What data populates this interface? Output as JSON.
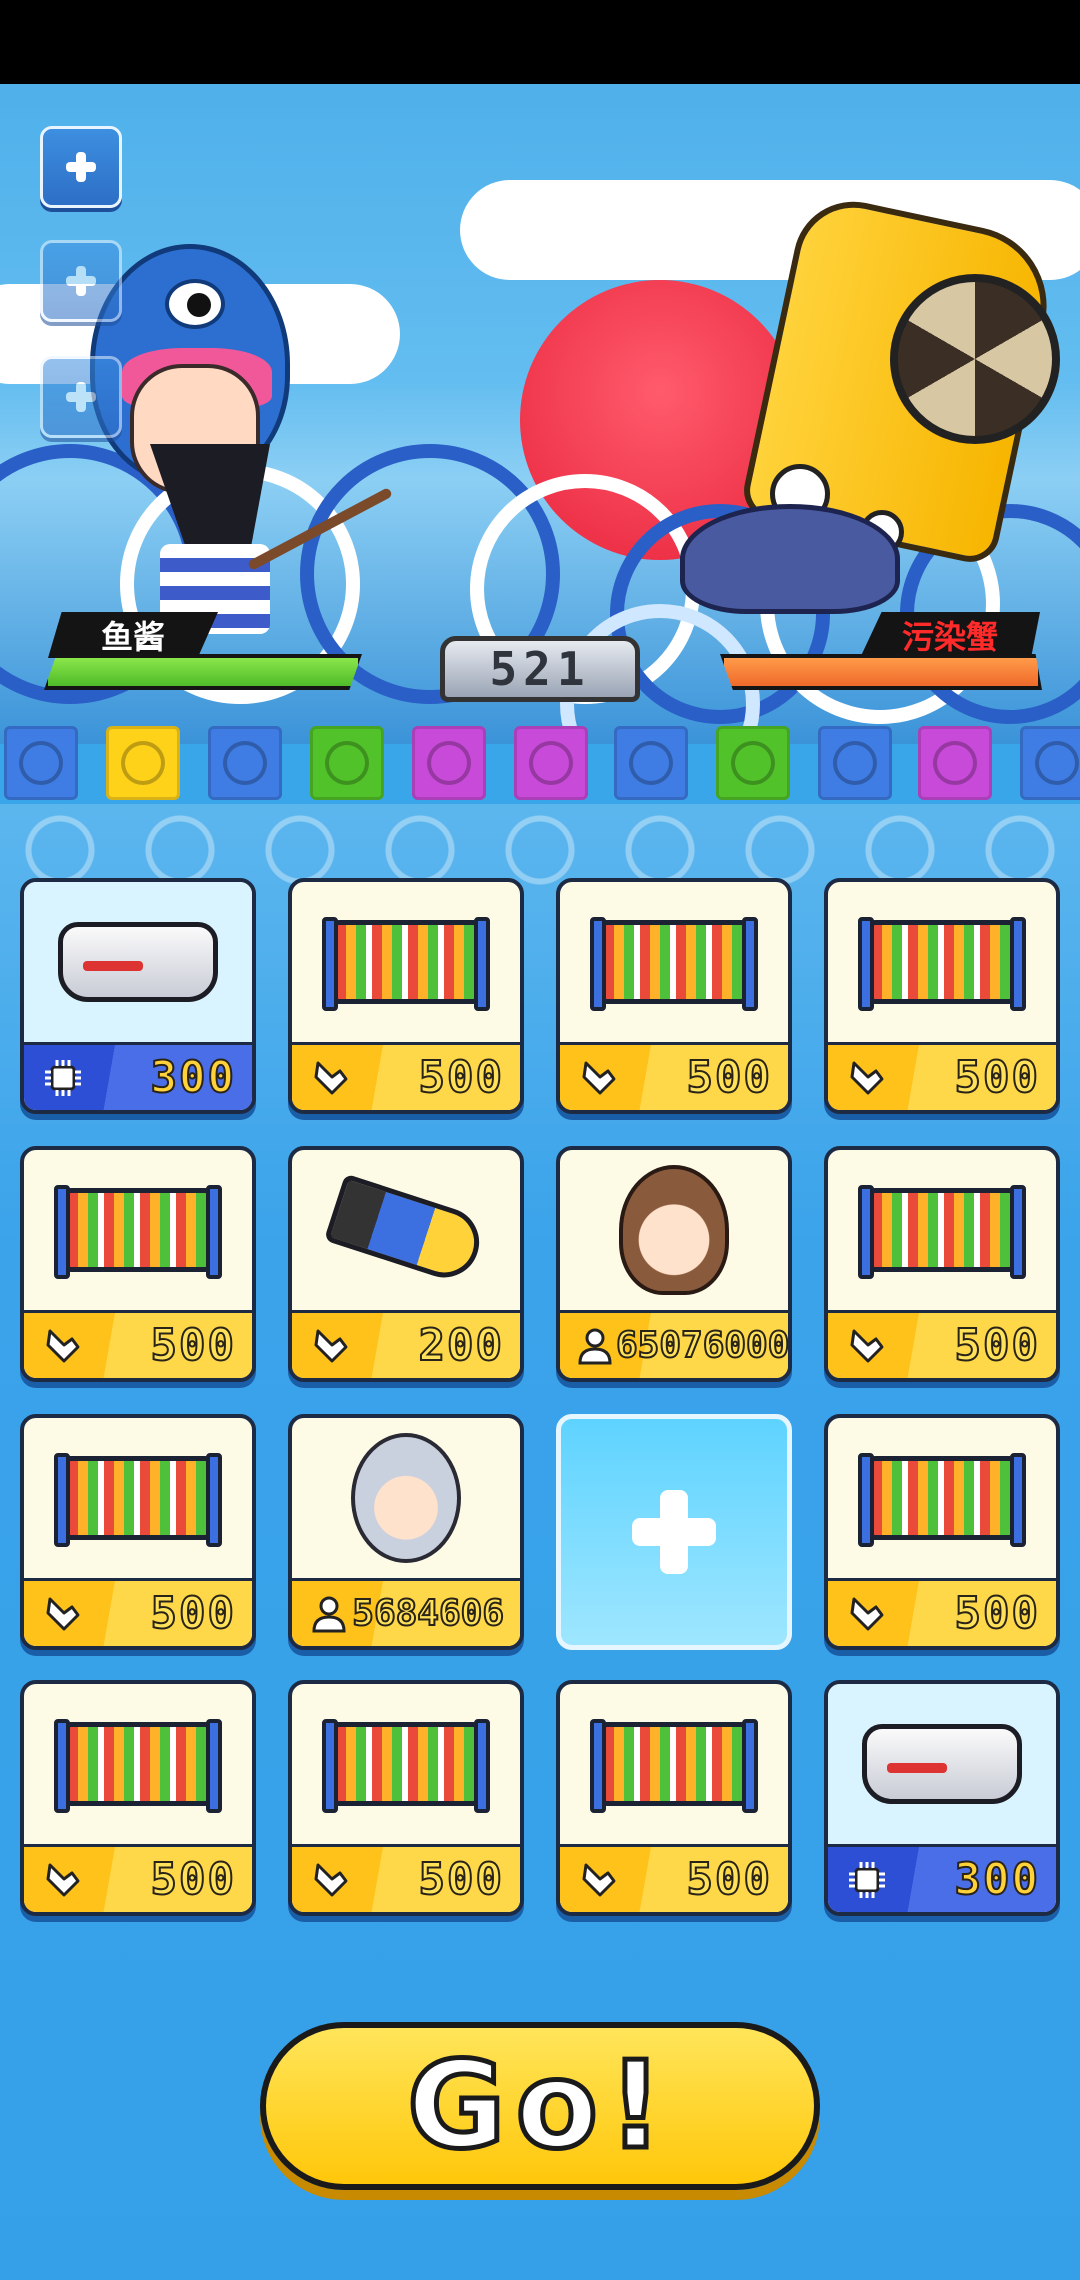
{
  "hero": {
    "name": "鱼酱"
  },
  "enemy": {
    "name": "污染蟹"
  },
  "score": "521",
  "side_buttons": [
    {
      "icon": "plus-icon"
    },
    {
      "icon": "plus-icon"
    },
    {
      "icon": "plus-icon"
    }
  ],
  "gems": [
    {
      "color": "#3f7de4"
    },
    {
      "color": "#ffd21a"
    },
    {
      "color": "#3f7de4"
    },
    {
      "color": "#52c22a"
    },
    {
      "color": "#c84ad8"
    },
    {
      "color": "#c84ad8"
    },
    {
      "color": "#3f7de4"
    },
    {
      "color": "#52c22a"
    },
    {
      "color": "#3f7de4"
    },
    {
      "color": "#c84ad8"
    },
    {
      "color": "#3f7de4"
    }
  ],
  "cards": [
    {
      "item": "vr-headset",
      "cost": "300",
      "cost_icon": "chip-icon"
    },
    {
      "item": "abacus",
      "cost": "500",
      "cost_icon": "hand-icon"
    },
    {
      "item": "abacus",
      "cost": "500",
      "cost_icon": "hand-icon"
    },
    {
      "item": "abacus",
      "cost": "500",
      "cost_icon": "hand-icon"
    },
    {
      "item": "abacus",
      "cost": "500",
      "cost_icon": "hand-icon"
    },
    {
      "item": "nuclear-bomb",
      "cost": "200",
      "cost_icon": "hand-icon"
    },
    {
      "item": "girl-character",
      "cost": "65076000",
      "cost_icon": "person-icon"
    },
    {
      "item": "abacus",
      "cost": "500",
      "cost_icon": "hand-icon"
    },
    {
      "item": "abacus",
      "cost": "500",
      "cost_icon": "hand-icon"
    },
    {
      "item": "old-scientist",
      "cost": "5684606",
      "cost_icon": "person-icon"
    },
    {
      "item": "empty-slot"
    },
    {
      "item": "abacus",
      "cost": "500",
      "cost_icon": "hand-icon"
    },
    {
      "item": "abacus",
      "cost": "500",
      "cost_icon": "hand-icon"
    },
    {
      "item": "abacus",
      "cost": "500",
      "cost_icon": "hand-icon"
    },
    {
      "item": "abacus",
      "cost": "500",
      "cost_icon": "hand-icon"
    },
    {
      "item": "vr-headset",
      "cost": "300",
      "cost_icon": "chip-icon"
    }
  ],
  "go_button": {
    "label": "Go!"
  },
  "colors": {
    "hero_hp": "#5fcc32",
    "enemy_hp": "#f07a30",
    "card_footer": "#ffc21a",
    "vr_footer": "#2c4fd6",
    "go_button": "#ffd21a"
  }
}
